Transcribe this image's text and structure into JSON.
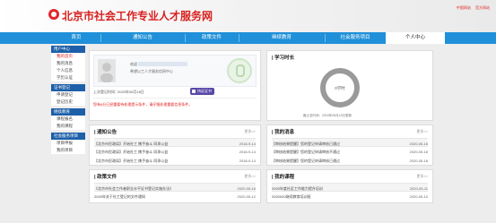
{
  "header": {
    "site_title": "北京市社会工作专业人才服务网",
    "links": [
      "中国网站",
      "官方网站"
    ]
  },
  "nav": {
    "items": [
      "首页",
      "通知公告",
      "政策文件",
      "继续教育",
      "社会服务项目",
      "个人中心"
    ],
    "active_index": 5
  },
  "sidebar": {
    "groups": [
      {
        "title": "用户中心",
        "items": [
          "我的首页",
          "我的消息",
          "个人信息",
          "学历认证"
        ]
      },
      {
        "title": "证书登记",
        "items": [
          "申请登记",
          "登记历史"
        ]
      },
      {
        "title": "继续教育",
        "items": [
          "课程报名",
          "我的课程"
        ]
      },
      {
        "title": "社会服务项目",
        "items": [
          "项目申报",
          "我的项目"
        ]
      }
    ],
    "active_item": "我的首页"
  },
  "profile": {
    "greeting": "欢迎",
    "subtitle": "希望以工人才服务信网中心",
    "last_login_label": "上次登记时间：",
    "last_login_value": "2020年05月18日",
    "cert_button": "持证证书",
    "notice": "您有6分已经重要待处理提示条件，请仔细处理重要信息条件。"
  },
  "study": {
    "title": "学习时长",
    "ring_value": "0",
    "ring_unit": "学时",
    "deadline": "截止至时间：2020年05月18日更新",
    "accent": "#5f6b74",
    "ring_color": "#9a9a9a"
  },
  "notices": {
    "title": "通知公告",
    "more": "更多>>",
    "rows": [
      {
        "text": "【北京市民政局】开始社工 携手奋斗 同承公益",
        "date": "2018-9-14"
      },
      {
        "text": "【北京市民政局】开始社工 携手奋斗 同承公益",
        "date": "2018-9-14"
      },
      {
        "text": "【北京市民政局】开始社工 携手奋斗 同承公益",
        "date": "2018-9-14"
      }
    ]
  },
  "messages": {
    "title": "我的消息",
    "more": "更多>>",
    "rows": [
      {
        "text": "【审核结果提醒】您的登记申请审核已通过",
        "date": "2020-05-18"
      },
      {
        "text": "【审核结果提醒】您的登记申请审核不通过",
        "date": "2020-05-18"
      },
      {
        "text": "【审核结果提醒】您的登记申请审核已通过",
        "date": "2020-05-18"
      }
    ]
  },
  "policies": {
    "title": "政策文件",
    "more": "更多>>",
    "rows": [
      {
        "text": "《北京市社会工作者职业水平证书登记实施办法》",
        "date": "2020-05-16"
      },
      {
        "text": "2020年关于社工登记的文件通知",
        "date": "2020-05-12"
      }
    ]
  },
  "courses": {
    "title": "我的课程",
    "more": "更多>>",
    "rows": [
      {
        "text": "2020年度社区工作能力提升培训",
        "date": "2020-05-11"
      },
      {
        "text": "2020020继续教育培训班",
        "date": "2020-05-10"
      }
    ]
  }
}
